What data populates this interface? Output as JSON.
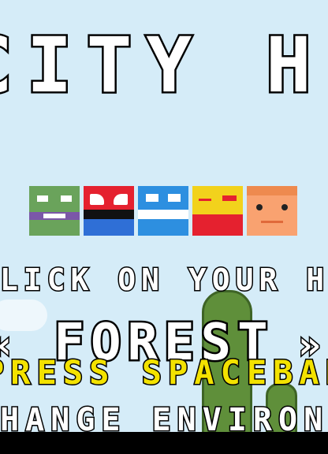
{
  "title": "CITY HERO",
  "prompt": "CLICK ON YOUR HERO TO PLAY",
  "environment": {
    "name": "FOREST",
    "left_arrow": "«",
    "right_arrow": "»"
  },
  "hints": {
    "line1": "PRESS SPACEBAR TO",
    "line2": "CHANGE ENVIRONMENT"
  },
  "heroes": [
    {
      "color": "#6aa35b"
    },
    {
      "color": "#e5212f"
    },
    {
      "color": "#2d8fe0"
    },
    {
      "color": "#f2d21c"
    },
    {
      "color": "#f9a270"
    }
  ]
}
